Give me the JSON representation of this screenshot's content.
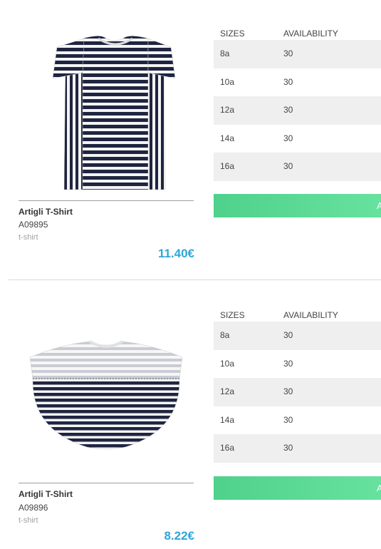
{
  "table_headers": {
    "sizes": "SIZES",
    "availability": "AVAILABILITY"
  },
  "products": [
    {
      "name": "Artigli T-Shirt",
      "code": "A09895",
      "category": "t-shirt",
      "price": "11.40€",
      "sizes": [
        {
          "size": "8a",
          "availability": "30"
        },
        {
          "size": "10a",
          "availability": "30"
        },
        {
          "size": "12a",
          "availability": "30"
        },
        {
          "size": "14a",
          "availability": "30"
        },
        {
          "size": "16a",
          "availability": "30"
        }
      ],
      "button_label": "A"
    },
    {
      "name": "Artigli T-Shirt",
      "code": "A09896",
      "category": "t-shirt",
      "price": "8.22€",
      "sizes": [
        {
          "size": "8a",
          "availability": "30"
        },
        {
          "size": "10a",
          "availability": "30"
        },
        {
          "size": "12a",
          "availability": "30"
        },
        {
          "size": "14a",
          "availability": "30"
        },
        {
          "size": "16a",
          "availability": "30"
        }
      ],
      "button_label": "A"
    }
  ],
  "colors": {
    "price": "#2fa6d9",
    "button": "#5ad997",
    "stripe": "#1f2540",
    "row_shade": "#efefef"
  }
}
